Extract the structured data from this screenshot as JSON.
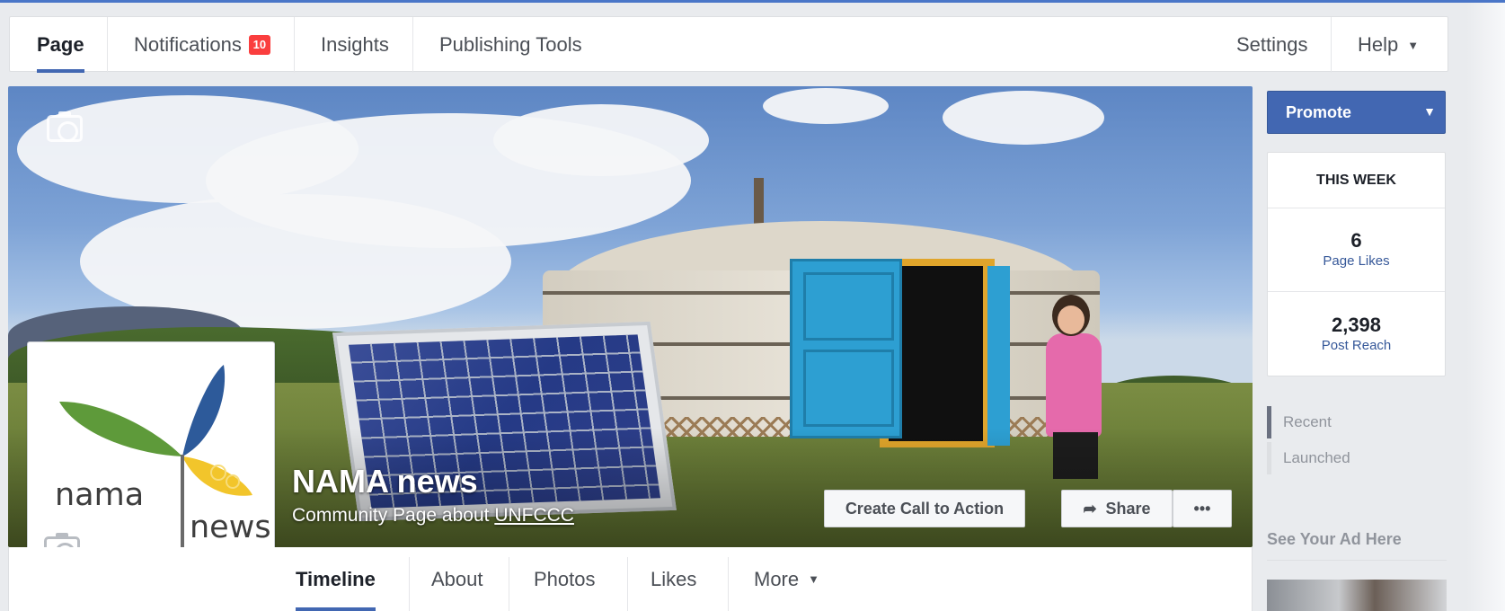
{
  "admin_nav": {
    "tabs": [
      {
        "label": "Page",
        "active": true
      },
      {
        "label": "Notifications",
        "badge": "10"
      },
      {
        "label": "Insights"
      },
      {
        "label": "Publishing Tools"
      }
    ],
    "right": [
      {
        "label": "Settings"
      },
      {
        "label": "Help"
      }
    ]
  },
  "cover": {
    "page_name": "NAMA news",
    "subtitle_prefix": "Community Page about",
    "subtitle_link": "UNFCCC",
    "cta_label": "Create Call to Action",
    "share_label": "Share",
    "more_label": "•••"
  },
  "profile": {
    "logo_word1": "nama",
    "logo_word2": "news"
  },
  "page_tabs": [
    {
      "label": "Timeline",
      "active": true
    },
    {
      "label": "About"
    },
    {
      "label": "Photos"
    },
    {
      "label": "Likes"
    },
    {
      "label": "More"
    }
  ],
  "right_column": {
    "promote_label": "Promote",
    "stats_title": "THIS WEEK",
    "stats": [
      {
        "value": "6",
        "label": "Page Likes"
      },
      {
        "value": "2,398",
        "label": "Post Reach"
      }
    ],
    "side_items": [
      {
        "label": "Recent",
        "active": true
      },
      {
        "label": "Launched"
      }
    ],
    "ad_heading": "See Your Ad Here"
  },
  "colors": {
    "accent": "#4267b2",
    "badge": "#fa3e3e",
    "link": "#365899"
  }
}
